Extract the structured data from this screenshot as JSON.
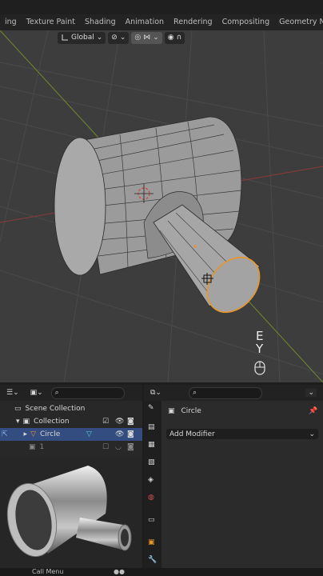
{
  "workspace_tabs": [
    "ing",
    "Texture Paint",
    "Shading",
    "Animation",
    "Rendering",
    "Compositing",
    "Geometry Nodes"
  ],
  "viewport_header": {
    "transform_orientation": "Global"
  },
  "gizmo_axis_labels": {
    "e": "E",
    "y": "Y"
  },
  "outliner": {
    "items": [
      {
        "label": "Scene Collection"
      },
      {
        "label": "Collection"
      },
      {
        "label": "Circle"
      },
      {
        "label": "1"
      }
    ]
  },
  "properties": {
    "object_name": "Circle",
    "add_modifier_label": "Add Modifier"
  },
  "statusbar": {
    "call_menu": "Call Menu"
  },
  "colors": {
    "accent": "#4772b3",
    "selection_orange": "#e7962b",
    "mesh_face": "#9a9a9a",
    "viewport_bg": "#3d3d3d"
  }
}
